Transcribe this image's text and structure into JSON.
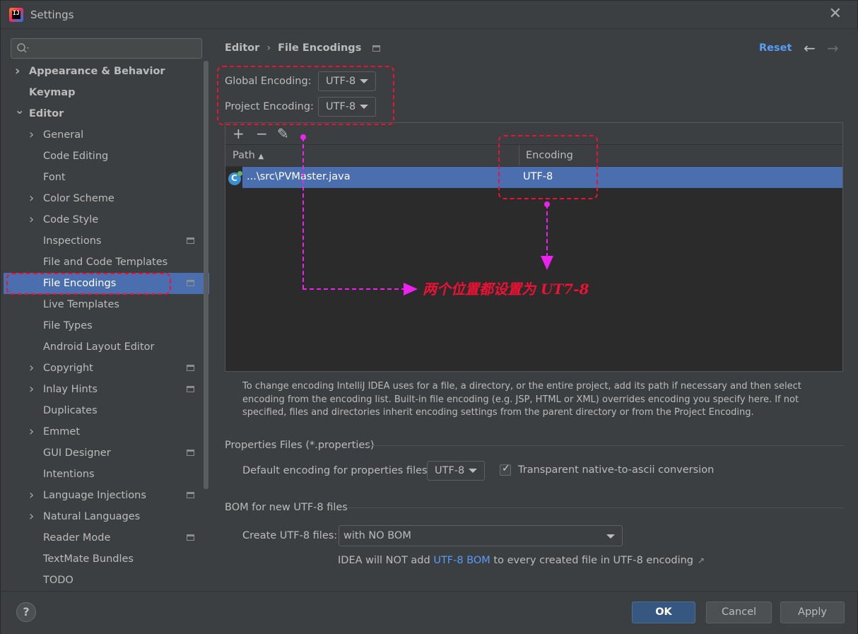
{
  "window": {
    "title": "Settings",
    "logo_text": "IJ"
  },
  "search": {
    "placeholder": ""
  },
  "sidebar": {
    "items": [
      {
        "label": "Appearance & Behavior",
        "level": 0,
        "chevron": "right",
        "bold": true
      },
      {
        "label": "Keymap",
        "level": 0,
        "bold": true
      },
      {
        "label": "Editor",
        "level": 0,
        "chevron": "down",
        "bold": true
      },
      {
        "label": "General",
        "level": 1,
        "chevron": "right"
      },
      {
        "label": "Code Editing",
        "level": 1
      },
      {
        "label": "Font",
        "level": 1
      },
      {
        "label": "Color Scheme",
        "level": 1,
        "chevron": "right"
      },
      {
        "label": "Code Style",
        "level": 1,
        "chevron": "right"
      },
      {
        "label": "Inspections",
        "level": 1,
        "project_icon": true
      },
      {
        "label": "File and Code Templates",
        "level": 1
      },
      {
        "label": "File Encodings",
        "level": 1,
        "project_icon": true,
        "selected": true
      },
      {
        "label": "Live Templates",
        "level": 1
      },
      {
        "label": "File Types",
        "level": 1
      },
      {
        "label": "Android Layout Editor",
        "level": 1
      },
      {
        "label": "Copyright",
        "level": 1,
        "chevron": "right",
        "project_icon": true
      },
      {
        "label": "Inlay Hints",
        "level": 1,
        "chevron": "right",
        "project_icon": true
      },
      {
        "label": "Duplicates",
        "level": 1
      },
      {
        "label": "Emmet",
        "level": 1,
        "chevron": "right"
      },
      {
        "label": "GUI Designer",
        "level": 1,
        "project_icon": true
      },
      {
        "label": "Intentions",
        "level": 1
      },
      {
        "label": "Language Injections",
        "level": 1,
        "chevron": "right",
        "project_icon": true
      },
      {
        "label": "Natural Languages",
        "level": 1,
        "chevron": "right"
      },
      {
        "label": "Reader Mode",
        "level": 1,
        "project_icon": true
      },
      {
        "label": "TextMate Bundles",
        "level": 1
      },
      {
        "label": "TODO",
        "level": 1
      }
    ]
  },
  "header": {
    "breadcrumb_parent": "Editor",
    "breadcrumb_separator": "›",
    "breadcrumb_current": "File Encodings",
    "reset_label": "Reset",
    "back_glyph": "←",
    "forward_glyph": "→"
  },
  "encodings": {
    "global_label": "Global Encoding:",
    "global_value": "UTF-8",
    "project_label": "Project Encoding:",
    "project_value": "UTF-8"
  },
  "table": {
    "toolbar": {
      "add": "+",
      "remove": "−",
      "edit": "✎"
    },
    "columns": {
      "path": "Path",
      "path_sort": "▲",
      "encoding": "Encoding"
    },
    "rows": [
      {
        "path": "...\\src\\PVMaster.java",
        "encoding": "UTF-8"
      }
    ]
  },
  "description": "To change encoding IntelliJ IDEA uses for a file, a directory, or the entire project, add its path if necessary and then select encoding from the encoding list. Built-in file encoding (e.g. JSP, HTML or XML) overrides encoding you specify here. If not specified, files and directories inherit encoding settings from the parent directory or from the Project Encoding.",
  "properties": {
    "section_title": "Properties Files (*.properties)",
    "default_label": "Default encoding for properties files:",
    "default_value": "UTF-8",
    "transparent_label": "Transparent native-to-ascii conversion",
    "transparent_checked": true
  },
  "bom": {
    "section_title": "BOM for new UTF-8 files",
    "create_label": "Create UTF-8 files:",
    "create_value": "with NO BOM",
    "note_prefix": "IDEA will NOT add ",
    "note_link": "UTF-8 BOM",
    "note_suffix": " to every created file in UTF-8 encoding",
    "note_arrow": "↗"
  },
  "footer": {
    "help": "?",
    "ok": "OK",
    "cancel": "Cancel",
    "apply": "Apply"
  },
  "annotation": {
    "text": "两个位置都设置为 UT7-8",
    "color": "#ee1133",
    "arrow_color": "#ee22ee"
  },
  "colors": {
    "selection": "#4b6eaf",
    "link": "#589df6",
    "background": "#3c3f41",
    "primary_button": "#365880"
  }
}
